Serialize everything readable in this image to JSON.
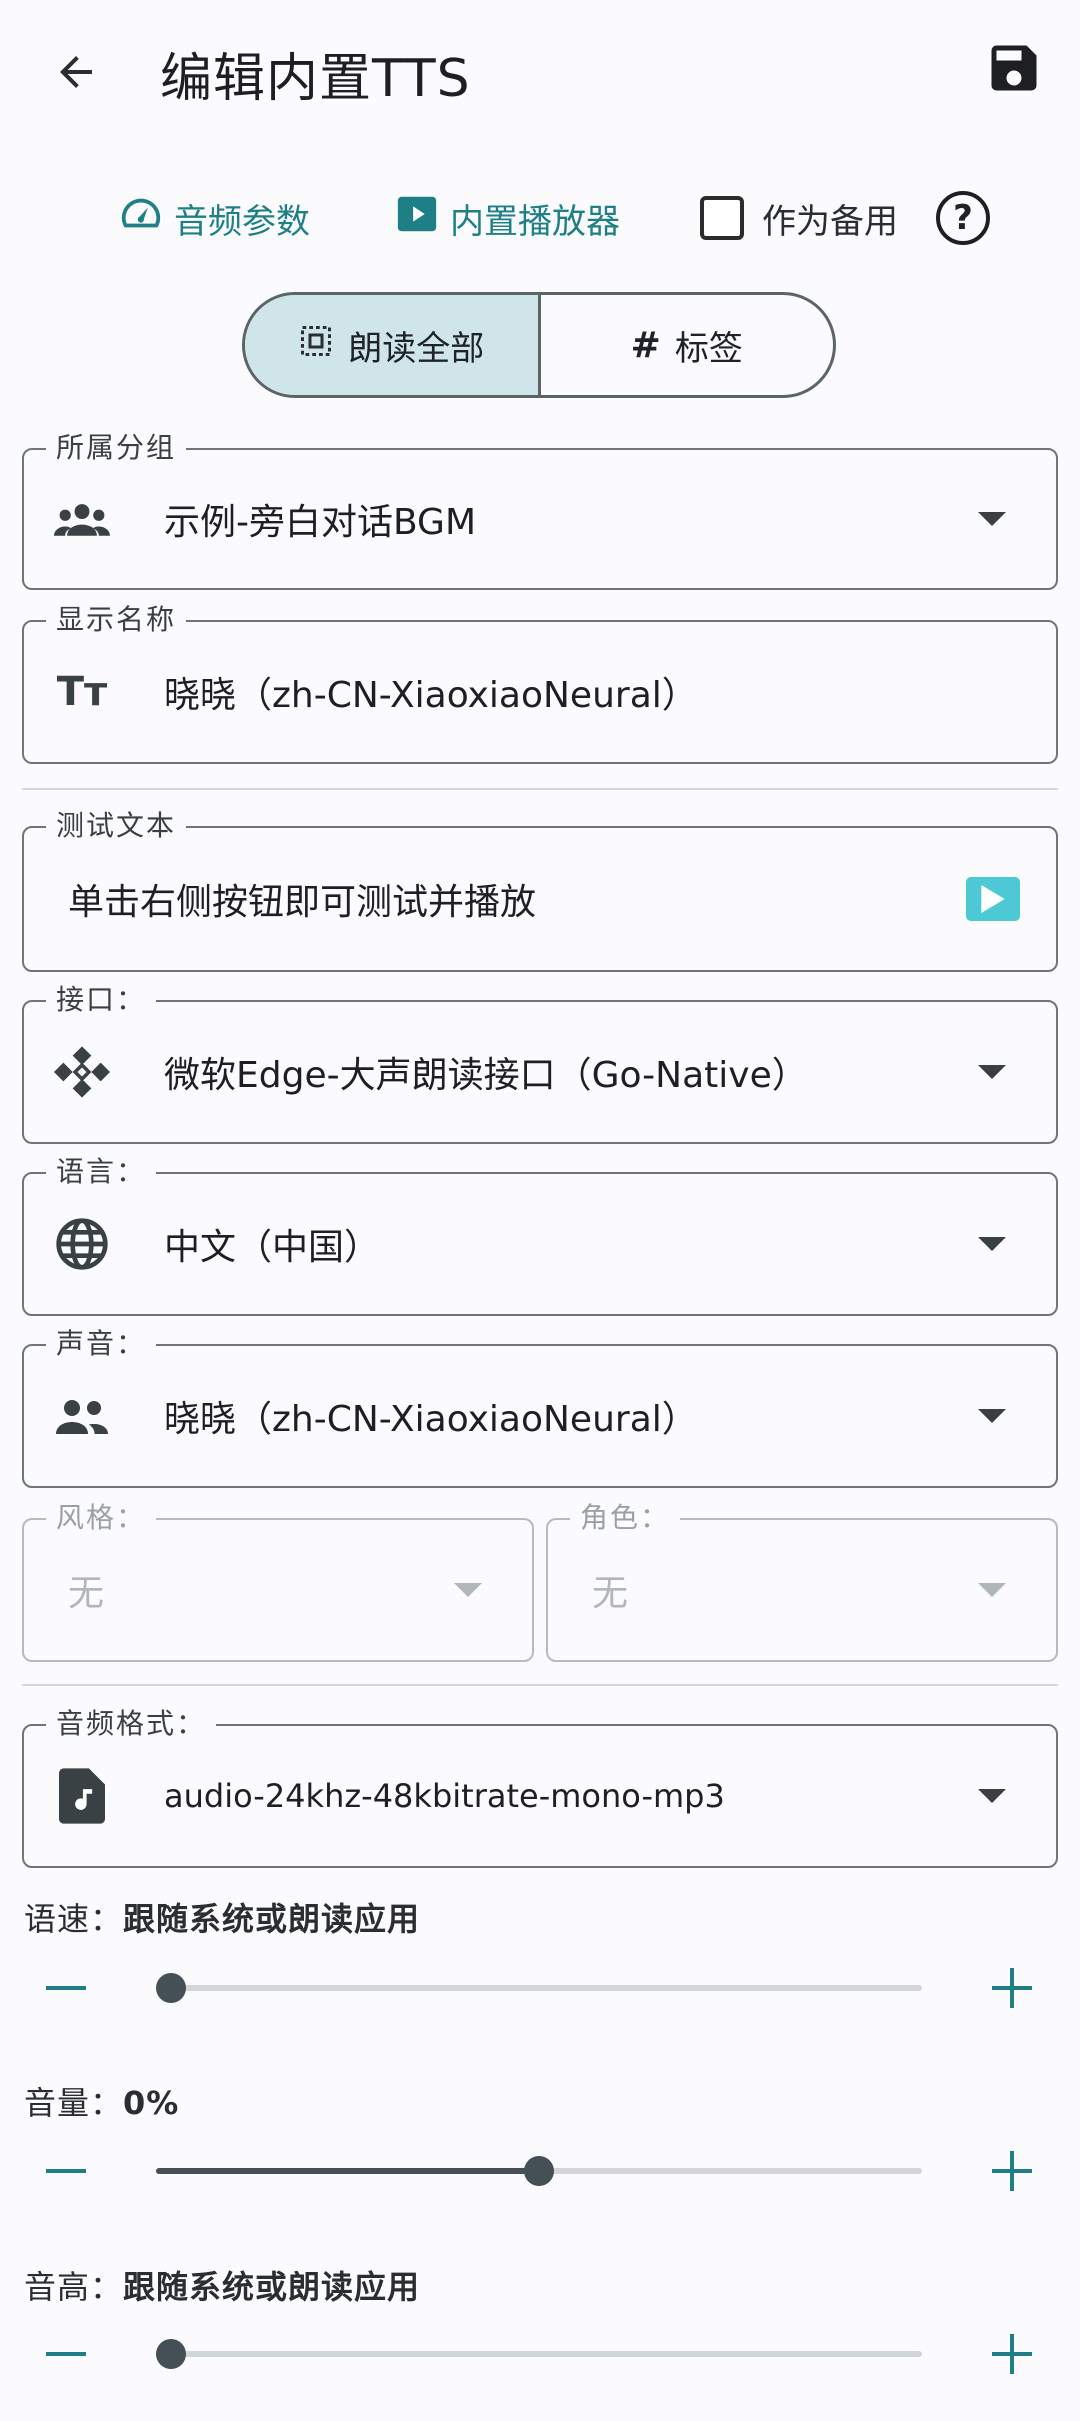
{
  "header": {
    "title": "编辑内置TTS"
  },
  "options": {
    "audio_params": "音频参数",
    "builtin_player": "内置播放器",
    "as_backup": "作为备用"
  },
  "segments": {
    "read_all": "朗读全部",
    "tags": "标签"
  },
  "fields": {
    "group": {
      "label": "所属分组",
      "value": "示例-旁白对话BGM"
    },
    "display_name": {
      "label": "显示名称",
      "value": "晓晓（zh-CN-XiaoxiaoNeural）"
    },
    "test_text": {
      "label": "测试文本",
      "value": "单击右侧按钮即可测试并播放"
    },
    "api": {
      "label": "接口：",
      "value": "微软Edge-大声朗读接口（Go-Native）"
    },
    "language": {
      "label": "语言：",
      "value": "中文（中国）"
    },
    "voice": {
      "label": "声音：",
      "value": "晓晓（zh-CN-XiaoxiaoNeural）"
    },
    "style": {
      "label": "风格：",
      "value": "无"
    },
    "role": {
      "label": "角色：",
      "value": "无"
    },
    "audio_format": {
      "label": "音频格式：",
      "value": "audio-24khz-48kbitrate-mono-mp3"
    }
  },
  "sliders": {
    "rate": {
      "label": "语速：",
      "value_text": "跟随系统或朗读应用",
      "level": 0
    },
    "volume": {
      "label": "音量：",
      "value_text": "0%",
      "level": 0.5
    },
    "pitch": {
      "label": "音高：",
      "value_text": "跟随系统或朗读应用",
      "level": 0
    }
  },
  "colors": {
    "accent": "#1f7f86",
    "play_button": "#4cc9d4",
    "segment_selected": "#cfe5ea"
  }
}
